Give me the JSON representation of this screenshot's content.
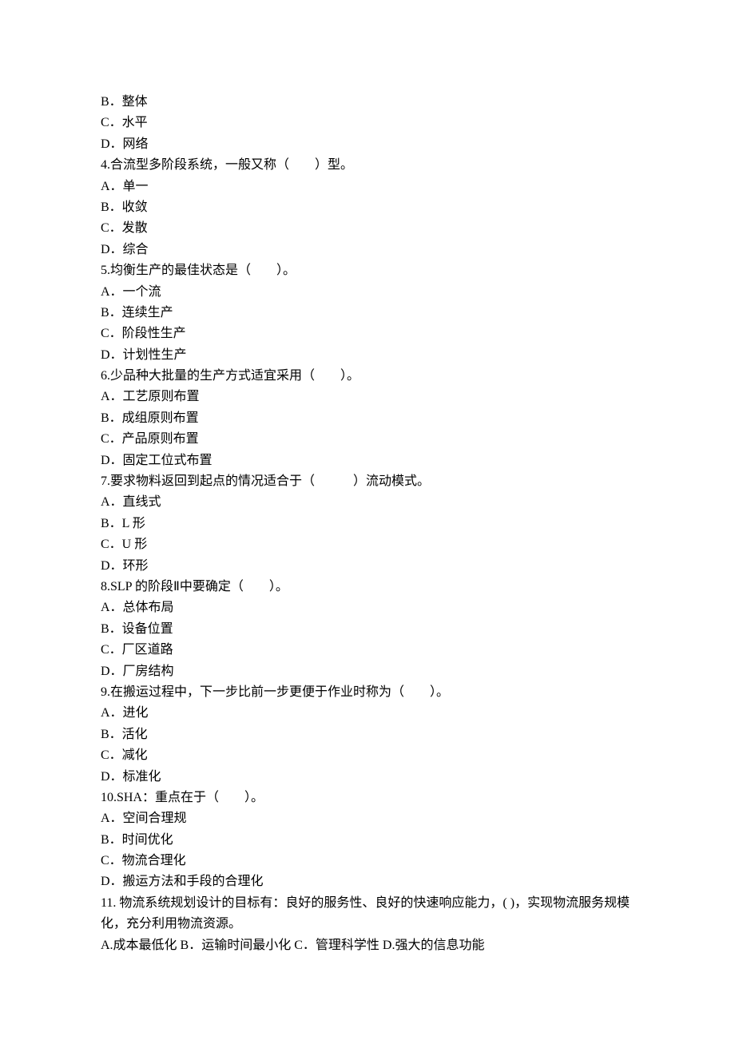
{
  "lines": [
    "B．整体",
    "C．水平",
    "D．网络",
    "4.合流型多阶段系统，一般又称（        ）型。",
    "A．单一",
    "B．收敛",
    "C．发散",
    "D．综合",
    "5.均衡生产的最佳状态是（        ）。",
    "A．一个流",
    "B．连续生产",
    "C．阶段性生产",
    "D．计划性生产",
    "6.少品种大批量的生产方式适宜采用（        ）。",
    "A．工艺原则布置",
    "B．成组原则布置",
    "C．产品原则布置",
    "D．固定工位式布置",
    "7.要求物料返回到起点的情况适合于（            ）流动模式。",
    "A．直线式",
    "B．L 形",
    "C．U 形",
    "D．环形",
    "8.SLP 的阶段Ⅱ中要确定（        ）。",
    "A．总体布局",
    "B．设备位置",
    "C．厂区道路",
    "D．厂房结构",
    "9.在搬运过程中，下一步比前一步更便于作业时称为（        ）。",
    "A．进化",
    "B．活化",
    "C．减化",
    "D．标准化",
    "10.SHA：重点在于（        ）。",
    "A．空间合理规",
    "B．时间优化",
    "C．物流合理化",
    "D．搬运方法和手段的合理化",
    "11. 物流系统规划设计的目标有：良好的服务性、良好的快速响应能力，( )，实现物流服务规模化，充分利用物流资源。",
    "A.成本最低化 B．运输时间最小化 C．管理科学性 D.强大的信息功能"
  ]
}
